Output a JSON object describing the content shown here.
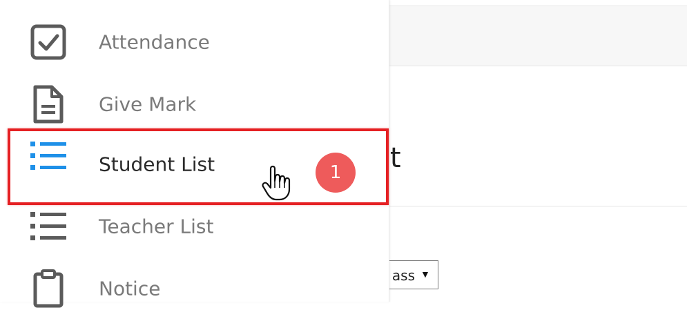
{
  "menu": {
    "items": [
      {
        "label": "Attendance",
        "icon": "checkbox-icon"
      },
      {
        "label": "Give Mark",
        "icon": "document-icon"
      },
      {
        "label": "Student List",
        "icon": "list-icon",
        "active": true
      },
      {
        "label": "Teacher List",
        "icon": "list-icon"
      },
      {
        "label": "Notice",
        "icon": "clipboard-icon"
      }
    ]
  },
  "background_page": {
    "heading_fragment": "st",
    "select_fragment": "ass"
  },
  "annotation": {
    "step_number": "1",
    "highlight_color": "#e52023",
    "badge_color": "#ee5b5b"
  },
  "colors": {
    "active_icon": "#1e90e8",
    "inactive_icon": "#5b5b5b"
  }
}
